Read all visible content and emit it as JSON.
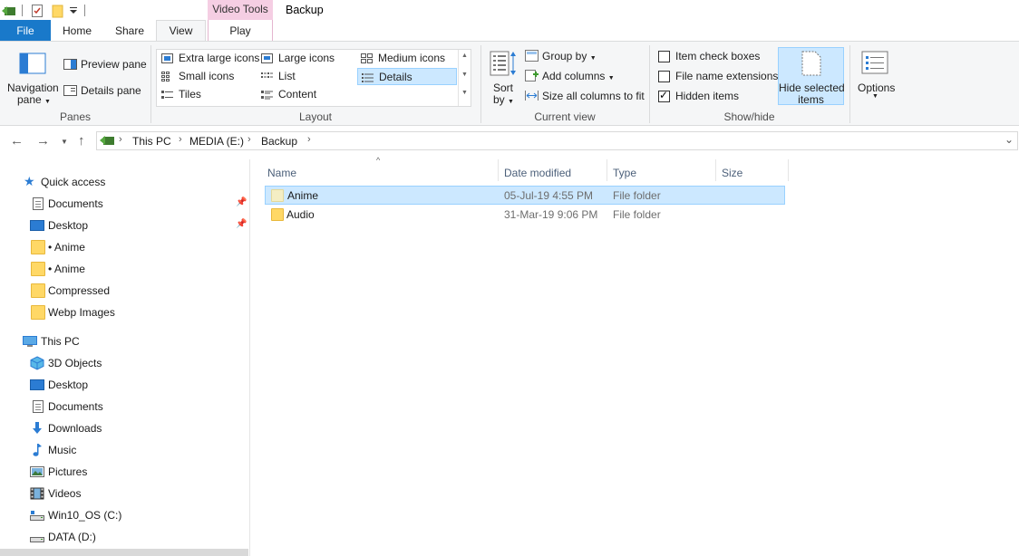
{
  "window": {
    "title": "Backup",
    "contextual_tab_group": "Video Tools"
  },
  "quick_access_toolbar": {
    "icons": [
      "explorer-icon",
      "properties-icon",
      "new-folder-icon",
      "customize-dropdown-icon"
    ]
  },
  "ribbon_tabs": {
    "file": "File",
    "home": "Home",
    "share": "Share",
    "view": "View",
    "play": "Play",
    "active": "View"
  },
  "panes_group": {
    "label": "Panes",
    "navigation_pane": [
      "Navigation",
      "pane"
    ],
    "preview_pane": "Preview pane",
    "details_pane": "Details pane"
  },
  "layout_group": {
    "label": "Layout",
    "options": {
      "extra_large_icons": "Extra large icons",
      "large_icons": "Large icons",
      "medium_icons": "Medium icons",
      "small_icons": "Small icons",
      "list": "List",
      "details": "Details",
      "tiles": "Tiles",
      "content": "Content"
    },
    "selected": "Details"
  },
  "current_view_group": {
    "label": "Current view",
    "sort_by": [
      "Sort",
      "by"
    ],
    "group_by": "Group by",
    "add_columns": "Add columns",
    "size_all_columns": "Size all columns to fit"
  },
  "show_hide_group": {
    "label": "Show/hide",
    "item_check_boxes": {
      "label": "Item check boxes",
      "checked": false
    },
    "file_name_extensions": {
      "label": "File name extensions",
      "checked": false
    },
    "hidden_items": {
      "label": "Hidden items",
      "checked": true
    },
    "hide_selected_items": [
      "Hide selected",
      "items"
    ]
  },
  "options_group": {
    "options": "Options"
  },
  "address_bar": {
    "breadcrumbs": [
      "This PC",
      "MEDIA (E:)",
      "Backup"
    ]
  },
  "navigation_pane": {
    "quick_access": {
      "label": "Quick access",
      "items": [
        {
          "label": "Documents",
          "pinned": true,
          "icon": "documents-icon"
        },
        {
          "label": "Desktop",
          "pinned": true,
          "icon": "desktop-icon"
        },
        {
          "label": "• Anime",
          "pinned": false,
          "icon": "folder-icon"
        },
        {
          "label": "• Anime",
          "pinned": false,
          "icon": "folder-icon"
        },
        {
          "label": "Compressed",
          "pinned": false,
          "icon": "folder-icon"
        },
        {
          "label": "Webp Images",
          "pinned": false,
          "icon": "folder-icon"
        }
      ]
    },
    "this_pc": {
      "label": "This PC",
      "items": [
        {
          "label": "3D Objects",
          "icon": "3d-objects-icon"
        },
        {
          "label": "Desktop",
          "icon": "desktop-icon"
        },
        {
          "label": "Documents",
          "icon": "documents-icon"
        },
        {
          "label": "Downloads",
          "icon": "downloads-icon"
        },
        {
          "label": "Music",
          "icon": "music-icon"
        },
        {
          "label": "Pictures",
          "icon": "pictures-icon"
        },
        {
          "label": "Videos",
          "icon": "videos-icon"
        },
        {
          "label": "Win10_OS (C:)",
          "icon": "drive-icon"
        },
        {
          "label": "DATA (D:)",
          "icon": "drive-icon"
        }
      ]
    }
  },
  "file_list": {
    "columns": {
      "name": "Name",
      "date_modified": "Date modified",
      "type": "Type",
      "size": "Size"
    },
    "sorted_by": "Name",
    "rows": [
      {
        "name": "Anime",
        "date_modified": "05-Jul-19 4:55 PM",
        "type": "File folder",
        "size": "",
        "selected": true
      },
      {
        "name": "Audio",
        "date_modified": "31-Mar-19 9:06 PM",
        "type": "File folder",
        "size": "",
        "selected": false
      }
    ]
  },
  "colors": {
    "file_tab": "#1979ca",
    "selection": "#cce8ff",
    "selection_border": "#99d1ff",
    "contextual_tab": "#f5cee3"
  }
}
